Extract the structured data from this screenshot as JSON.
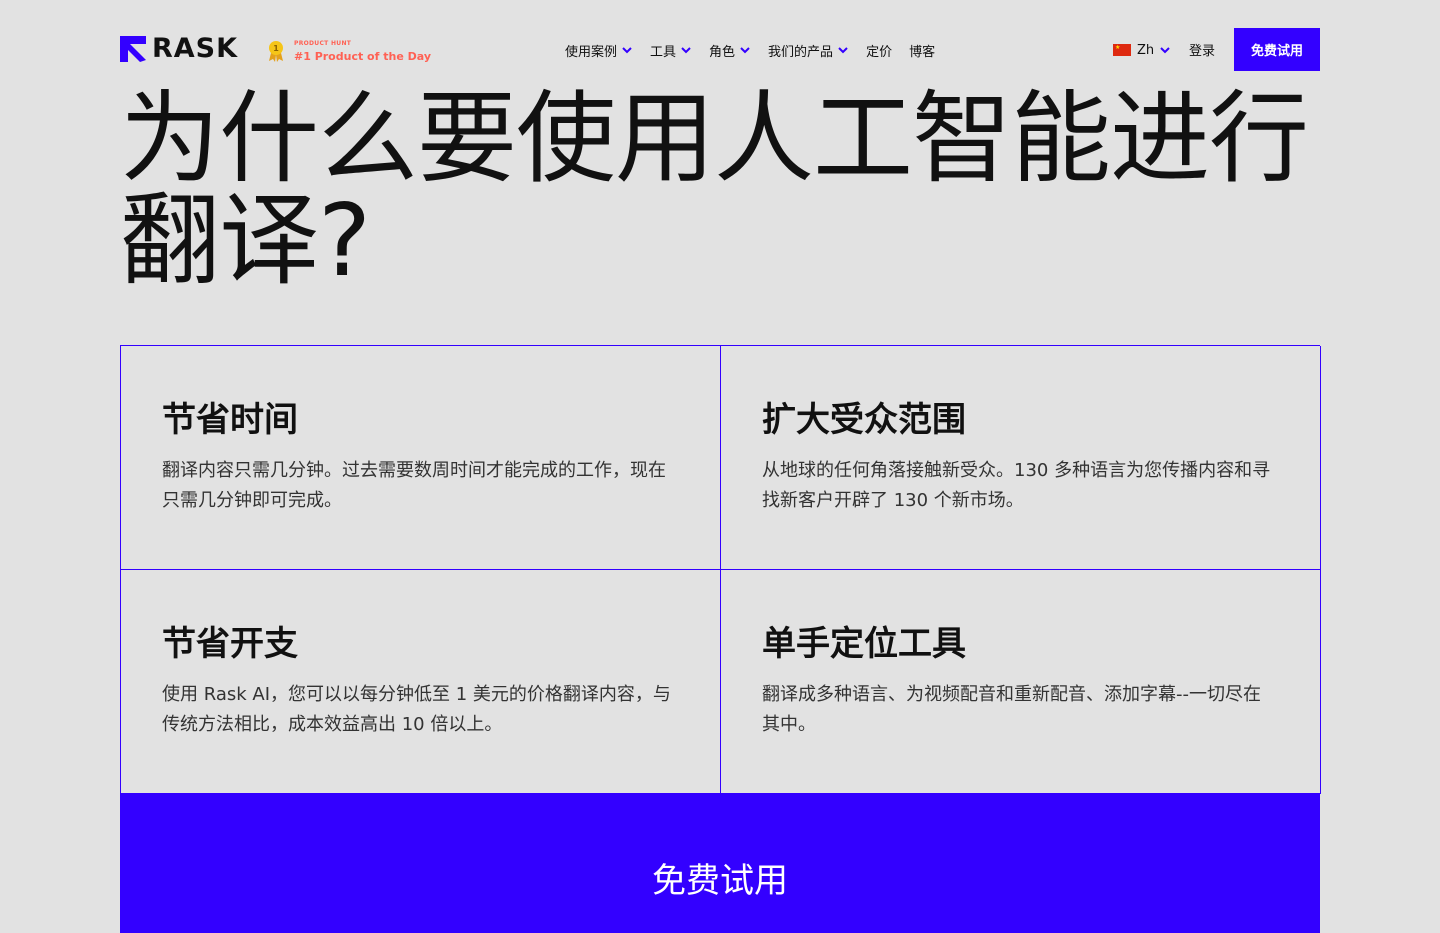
{
  "header": {
    "logo_text": "RASK",
    "product_hunt_small": "PRODUCT HUNT",
    "product_hunt_big": "#1 Product of the Day",
    "nav": [
      {
        "label": "使用案例",
        "has_dropdown": true
      },
      {
        "label": "工具",
        "has_dropdown": true
      },
      {
        "label": "角色",
        "has_dropdown": true
      },
      {
        "label": "我们的产品",
        "has_dropdown": true
      },
      {
        "label": "定价",
        "has_dropdown": false
      },
      {
        "label": "博客",
        "has_dropdown": false
      }
    ],
    "language": "Zh",
    "login_label": "登录",
    "cta_label": "免费试用"
  },
  "hero": {
    "title": "为什么要使用人工智能进行翻译?"
  },
  "features": [
    {
      "title": "节省时间",
      "description": "翻译内容只需几分钟。过去需要数周时间才能完成的工作，现在只需几分钟即可完成。"
    },
    {
      "title": "扩大受众范围",
      "description": "从地球的任何角落接触新受众。130 多种语言为您传播内容和寻找新客户开辟了 130 个新市场。"
    },
    {
      "title": "节省开支",
      "description": "使用 Rask AI，您可以以每分钟低至 1 美元的价格翻译内容，与传统方法相比，成本效益高出 10 倍以上。"
    },
    {
      "title": "单手定位工具",
      "description": "翻译成多种语言、为视频配音和重新配音、添加字幕--一切尽在其中。"
    }
  ],
  "bottom_cta_label": "免费试用",
  "colors": {
    "accent": "#3300ff",
    "background": "#e2e2e2",
    "product_hunt": "#ff6154"
  },
  "icons": [
    "rask-logo-icon",
    "product-hunt-medal-icon",
    "chevron-down-icon",
    "china-flag-icon"
  ]
}
